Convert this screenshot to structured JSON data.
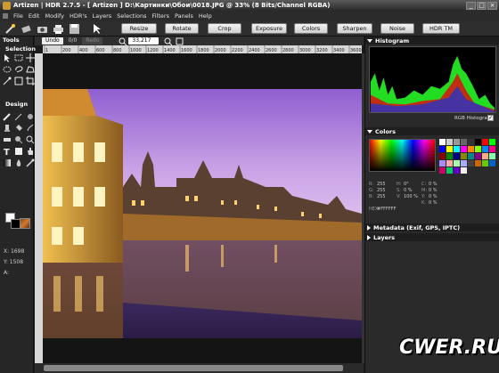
{
  "app": {
    "title": "Artizen  |  HDR 2.7.5 - [  Artizen  ]  D:\\Картинки\\Обои\\0018.JPG @ 33% (8 Bits/Channel RGBA)"
  },
  "window_buttons": [
    "_",
    "□",
    "×"
  ],
  "menu": [
    "File",
    "Edit",
    "Modify",
    "HDR's",
    "Layers",
    "Selections",
    "Filters",
    "Panels",
    "Help"
  ],
  "toolbar": {
    "buttons": [
      "Resize",
      "Rotate",
      "Crop",
      "Exposure",
      "Colors",
      "Sharpen",
      "Noise",
      "HDR TM"
    ]
  },
  "doc": {
    "undo": "Undo",
    "counter": "0/0",
    "redo": "Redo",
    "zoom": "33,217"
  },
  "ruler_ticks": [
    "1",
    "200",
    "400",
    "600",
    "800",
    "1000",
    "1200",
    "1400",
    "1600",
    "1800",
    "2000",
    "2200",
    "2400",
    "2600",
    "2800",
    "3000",
    "3200",
    "3400",
    "3600"
  ],
  "tools": {
    "header": "Tools",
    "selection": "Selection",
    "design": "Design"
  },
  "coords": {
    "x": "X: 1698",
    "y": "Y: 1508",
    "a": "A:"
  },
  "panels": {
    "histogram": "Histogram",
    "histogram_mode": "RGB Histogram",
    "colors": "Colors",
    "metadata": "Metadata (Exif, GPS, IPTC)",
    "layers": "Layers"
  },
  "color_values": [
    [
      "R:",
      "255",
      "H:",
      "0°",
      "C:",
      "0 %"
    ],
    [
      "G:",
      "255",
      "S:",
      "0 %",
      "M:",
      "0 %"
    ],
    [
      "B:",
      "255",
      "V:",
      "100 %",
      "Y:",
      "0 %"
    ],
    [
      "",
      "",
      "",
      "",
      "K:",
      "0 %"
    ],
    [
      "HEX:",
      "#FFFFFF",
      "",
      "",
      "",
      ""
    ]
  ],
  "watermark": "CWER.RU",
  "colors": {
    "accent_button": "#e8e8e8",
    "histogram_green": "#22dd22",
    "histogram_red": "#dd1111"
  }
}
